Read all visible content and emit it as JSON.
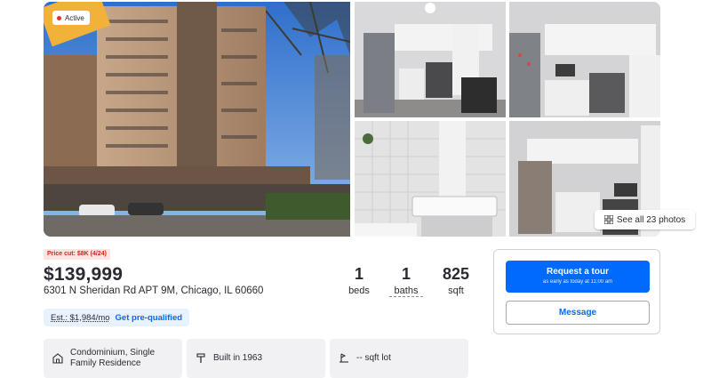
{
  "gallery": {
    "status_badge": "Active",
    "see_all_label": "See all 23 photos"
  },
  "listing": {
    "price_cut": "Price cut: $8K (4/24)",
    "price": "$139,999",
    "address": "6301 N Sheridan Rd APT 9M, Chicago, IL 60660",
    "facts": {
      "beds_value": "1",
      "beds_label": "beds",
      "baths_value": "1",
      "baths_label": "baths",
      "sqft_value": "825",
      "sqft_label": "sqft"
    },
    "estimate": "Est.: $1,984/mo",
    "prequalified_link": "Get pre-qualified"
  },
  "fact_cards": [
    {
      "icon": "building-icon",
      "text": "Condominium, Single Family Residence"
    },
    {
      "icon": "hammer-icon",
      "text": "Built in 1963"
    },
    {
      "icon": "lot-icon",
      "text": "-- sqft lot"
    }
  ],
  "contact": {
    "tour_label": "Request a tour",
    "tour_sublabel": "as early as today at 11:00 am",
    "message_label": "Message"
  },
  "colors": {
    "accent": "#006aff",
    "active_dot": "#e0332a",
    "price_cut_bg": "#fde3e1",
    "price_cut_text": "#c42b1c"
  }
}
